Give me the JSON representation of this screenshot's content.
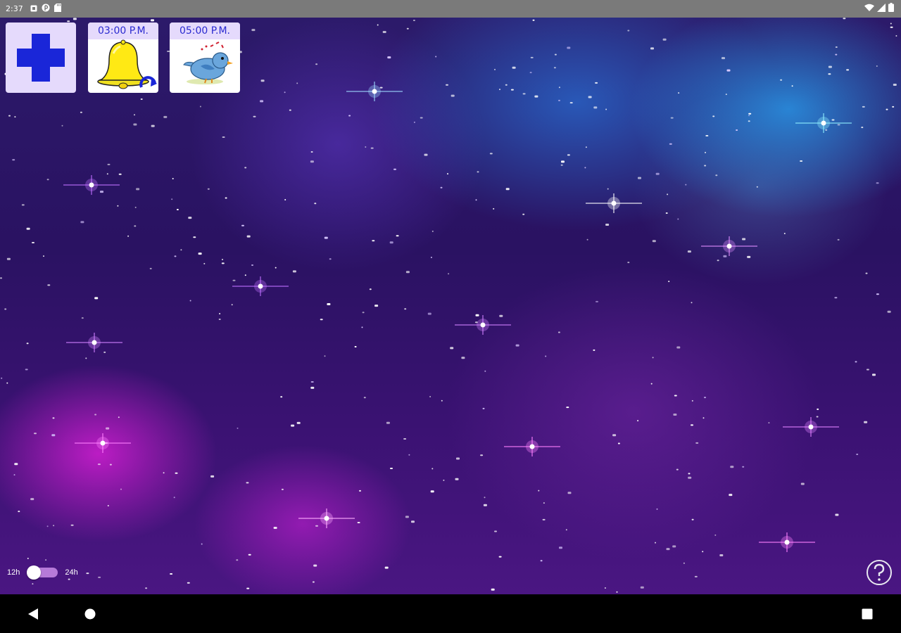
{
  "status_bar": {
    "time": "2:37",
    "left_icons": [
      "notification-icon",
      "pinterest-icon",
      "sd-card-icon"
    ],
    "right_icons": [
      "wifi-icon",
      "signal-icon",
      "battery-icon"
    ]
  },
  "tiles": {
    "add": {
      "icon": "plus-icon",
      "color": "#1a26d8"
    },
    "alarms": [
      {
        "time": "03:00 P.M.",
        "icon": "bell-icon",
        "repeat": true
      },
      {
        "time": "05:00 P.M.",
        "icon": "bird-icon",
        "repeat": false
      }
    ]
  },
  "clock_format": {
    "left_label": "12h",
    "right_label": "24h",
    "selected": "12h"
  },
  "help": {
    "icon": "help-icon"
  },
  "nav_bar": {
    "items": [
      "back-icon",
      "home-icon",
      "recents-icon"
    ]
  },
  "colors": {
    "tile_header": "#e5dafc",
    "tile_header_text": "#2a2ad0",
    "status_bar": "#7a7a7a",
    "toggle_track": "#b67ad8"
  }
}
